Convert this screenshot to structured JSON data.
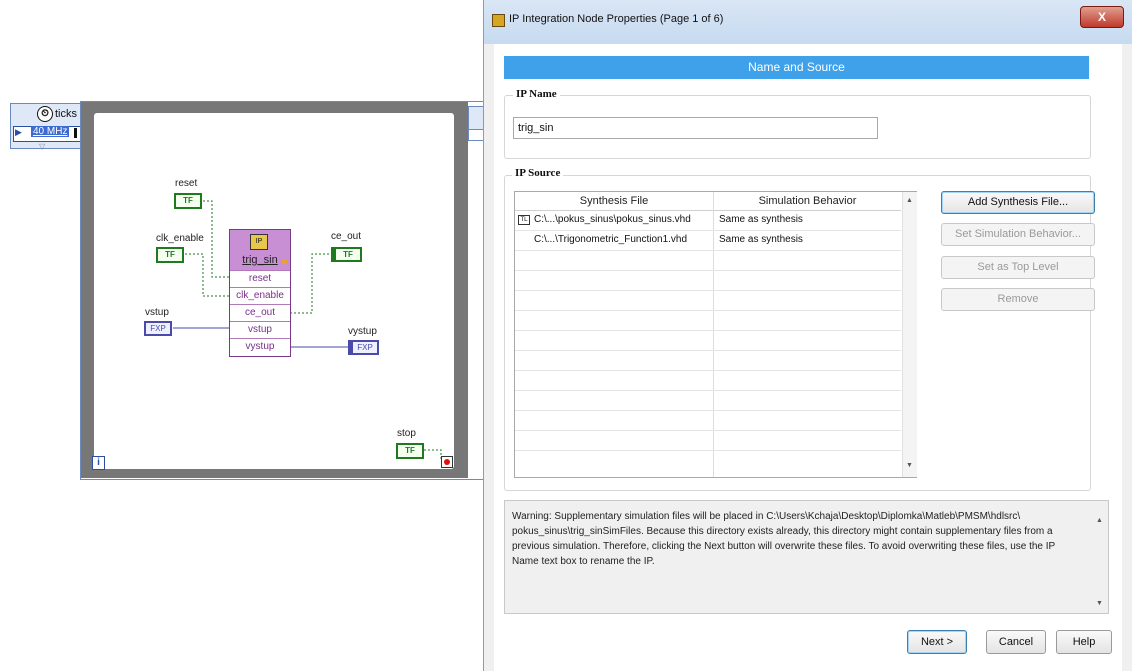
{
  "diagram": {
    "clock": {
      "label": "ticks",
      "frequency": "40 MHz"
    },
    "controls": {
      "reset": {
        "label": "reset",
        "type": "TF"
      },
      "clk_enable": {
        "label": "clk_enable",
        "type": "TF"
      },
      "vstup": {
        "label": "vstup",
        "type": "FXP"
      },
      "stop": {
        "label": "stop",
        "type": "TF"
      }
    },
    "indicators": {
      "ce_out": {
        "label": "ce_out",
        "type": "TF"
      },
      "vystup": {
        "label": "vystup",
        "type": "FXP"
      }
    },
    "ip_node": {
      "name": "trig_sin",
      "terminals": [
        "reset",
        "clk_enable",
        "ce_out",
        "vstup",
        "vystup"
      ]
    },
    "loop_iteration": "i"
  },
  "dialog": {
    "title": "IP Integration Node Properties (Page 1 of 6)",
    "close_glyph": "X",
    "banner": "Name and Source",
    "ip_name": {
      "group_label": "IP Name",
      "value": "trig_sin"
    },
    "ip_source": {
      "group_label": "IP Source",
      "columns": [
        "Synthesis File",
        "Simulation Behavior"
      ],
      "rows": [
        {
          "file": "C:\\...\\pokus_sinus\\pokus_sinus.vhd",
          "behavior": "Same as synthesis",
          "top_level": true,
          "icon": "top-level-file-icon"
        },
        {
          "file": "C:\\...\\Trigonometric_Function1.vhd",
          "behavior": "Same as synthesis",
          "top_level": false
        }
      ],
      "buttons": {
        "add": "Add Synthesis File...",
        "set_sim": "Set Simulation Behavior...",
        "set_top": "Set as Top Level",
        "remove": "Remove"
      }
    },
    "warning": "Warning: Supplementary simulation files will be placed in C:\\Users\\Kchaja\\Desktop\\Diplomka\\Matleb\\PMSM\\hdlsrc\\ pokus_sinus\\trig_sinSimFiles. Because this directory exists already, this directory might contain supplementary files from a previous simulation. Therefore, clicking the Next button will overwrite these files. To avoid overwriting these files, use the IP Name text box to rename the IP.",
    "footer": {
      "next": "Next >",
      "cancel": "Cancel",
      "help": "Help"
    }
  },
  "colors": {
    "banner": "#3fa1ea",
    "boolean_wire": "#1d7a1d",
    "fixed_point_wire": "#4a4aa8",
    "ip_node_header": "#c98fd5",
    "loop_frame": "#777777"
  }
}
